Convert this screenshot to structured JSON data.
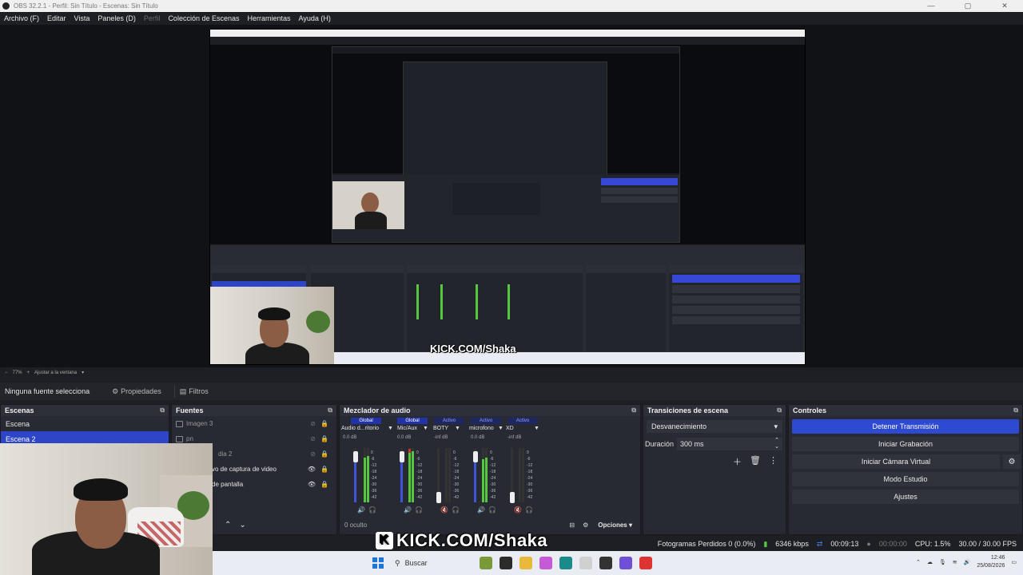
{
  "window": {
    "title": "OBS 32.2.1 - Perfil: Sin Título - Escenas: Sin Título",
    "min": "—",
    "max": "▢",
    "close": "✕"
  },
  "menu": {
    "items": [
      "Archivo (F)",
      "Editar",
      "Vista",
      "Paneles (D)",
      "Perfil",
      "Colección de Escenas",
      "Herramientas",
      "Ayuda (H)"
    ]
  },
  "preview": {
    "nested_watermark": "KICK.COM/Shaka"
  },
  "zoom_bar": {
    "zoom_out": "−",
    "zoom_value": "77%",
    "zoom_in": "+",
    "fit": "Ajustar a la ventana",
    "dropdown": "▾"
  },
  "source_toolbar": {
    "no_source": "Ninguna fuente selecciona",
    "properties": "Propiedades",
    "filters": "Filtros"
  },
  "scenes": {
    "title": "Escenas",
    "items": [
      "Escena",
      "Escena 2"
    ],
    "selected_index": 1
  },
  "sources": {
    "title": "Fuentes",
    "items": [
      "Imagen 3",
      "pn",
      "dia 2",
      "vo de captura de video",
      "de pantalla"
    ]
  },
  "mixer": {
    "title": "Mezclador de audio",
    "tags": [
      "Global",
      "Global",
      "Activo",
      "Activo",
      "Activo"
    ],
    "channels": [
      {
        "name": "Audio d...ritorio",
        "db": "0.0 dB"
      },
      {
        "name": "Mic/Aux",
        "db": "0.0 dB"
      },
      {
        "name": "BOTY",
        "db": "-inf dB"
      },
      {
        "name": "microfono",
        "db": "0.0 dB"
      },
      {
        "name": "XD",
        "db": "-inf dB"
      }
    ],
    "scale": [
      "0",
      "-6",
      "-12",
      "-18",
      "-24",
      "-30",
      "-36",
      "-42",
      "-48",
      "-54",
      "-60"
    ],
    "hidden": "0 oculto",
    "options": "Opciones"
  },
  "transitions": {
    "title": "Transiciones de escena",
    "selected": "Desvanecimiento",
    "duration_label": "Duración",
    "duration_value": "300 ms"
  },
  "controls": {
    "title": "Controles",
    "stop_stream": "Detener Transmisión",
    "start_recording": "Iniciar Grabación",
    "start_virtual_cam": "Iniciar Cámara Virtual",
    "studio_mode": "Modo Estudio",
    "settings": "Ajustes"
  },
  "status": {
    "dropped_frames": "Fotogramas Perdidos 0 (0.0%)",
    "bitrate": "6346 kbps",
    "stream_time": "00:09:13",
    "rec_time": "00:00:00",
    "cpu": "CPU: 1.5%",
    "fps": "30.00 / 30.00 FPS"
  },
  "taskbar": {
    "search": "Buscar",
    "time": "12:46",
    "date": "25/08/2026"
  },
  "overlay": {
    "watermark": "KICK.COM/Shaka",
    "k_letter": "K"
  },
  "colors": {
    "accent": "#2e4ad2",
    "selected": "#2d45c6",
    "meter_green": "#55c840",
    "meter_blue": "#3e55d9"
  }
}
